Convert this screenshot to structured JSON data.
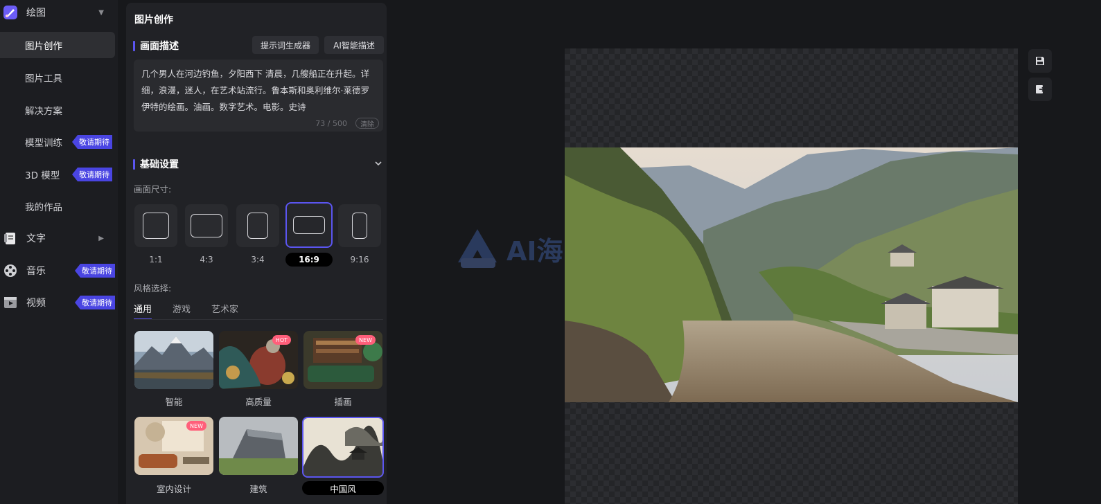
{
  "sidebar": {
    "groups": [
      {
        "label": "绘图"
      },
      {
        "label": "文字"
      },
      {
        "label": "音乐",
        "badge": "敬请期待"
      },
      {
        "label": "视频",
        "badge": "敬请期待"
      }
    ],
    "items": [
      {
        "label": "图片创作"
      },
      {
        "label": "图片工具"
      },
      {
        "label": "解决方案"
      },
      {
        "label": "模型训练",
        "badge": "敬请期待"
      },
      {
        "label": "3D 模型",
        "badge": "敬请期待"
      },
      {
        "label": "我的作品"
      }
    ]
  },
  "panel": {
    "title": "图片创作",
    "description": {
      "header": "画面描述",
      "prompt_generator": "提示词生成器",
      "ai_describe": "AI智能描述",
      "text": "几个男人在河边钓鱼，夕阳西下 清晨，几艘船正在升起。详细，浪漫，迷人，在艺术站流行。鲁本斯和奥利维尔·莱德罗伊特的绘画。油画。数字艺术。电影。史诗",
      "count": "73 / 500",
      "clear": "清除"
    },
    "basic": {
      "header": "基础设置",
      "size_label": "画面尺寸:",
      "ratios": [
        "1:1",
        "4:3",
        "3:4",
        "16:9",
        "9:16"
      ],
      "selected_ratio": "16:9",
      "style_label": "风格选择:",
      "tabs": [
        "通用",
        "游戏",
        "艺术家"
      ],
      "styles": [
        {
          "label": "智能"
        },
        {
          "label": "高质量",
          "tag": "HOT"
        },
        {
          "label": "插画",
          "tag": "NEW"
        },
        {
          "label": "室内设计",
          "tag": "NEW"
        },
        {
          "label": "建筑"
        },
        {
          "label": "中国风"
        }
      ],
      "selected_style": "中国风"
    }
  },
  "canvas": {
    "watermark": "AI海"
  },
  "colors": {
    "accent": "#5b55f0",
    "badge": "#4a45e2",
    "tag": "#ff5f7a"
  }
}
